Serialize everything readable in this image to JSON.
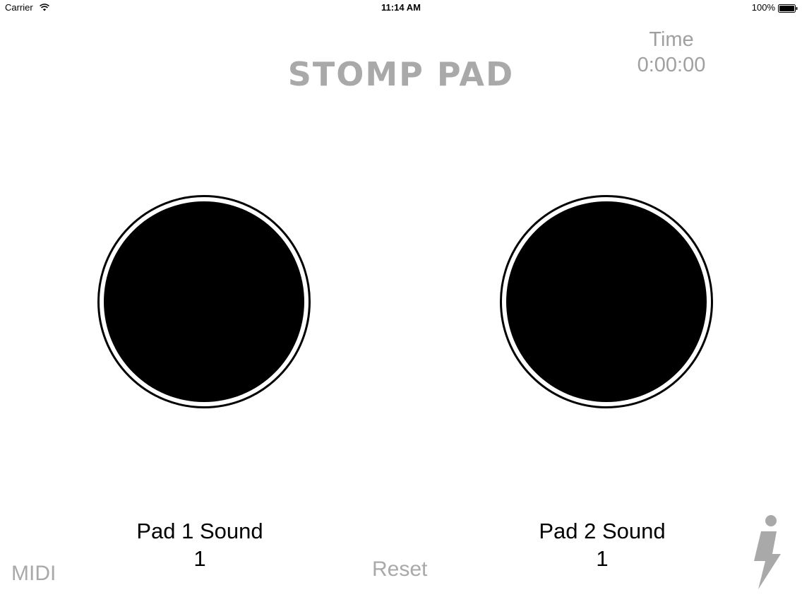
{
  "status_bar": {
    "carrier": "Carrier",
    "time": "11:14 AM",
    "battery": "100%"
  },
  "header": {
    "title": "STOMP PAD",
    "timer_label": "Time",
    "timer_value": "0:00:00"
  },
  "pads": [
    {
      "sound_label": "Pad 1 Sound",
      "sound_value": "1"
    },
    {
      "sound_label": "Pad 2 Sound",
      "sound_value": "1"
    }
  ],
  "footer": {
    "midi_label": "MIDI",
    "reset_label": "Reset",
    "info_icon": "lightning-info-icon"
  },
  "colors": {
    "accent_gray": "#a9a9a9",
    "pad_fill": "#000000",
    "background": "#ffffff"
  }
}
